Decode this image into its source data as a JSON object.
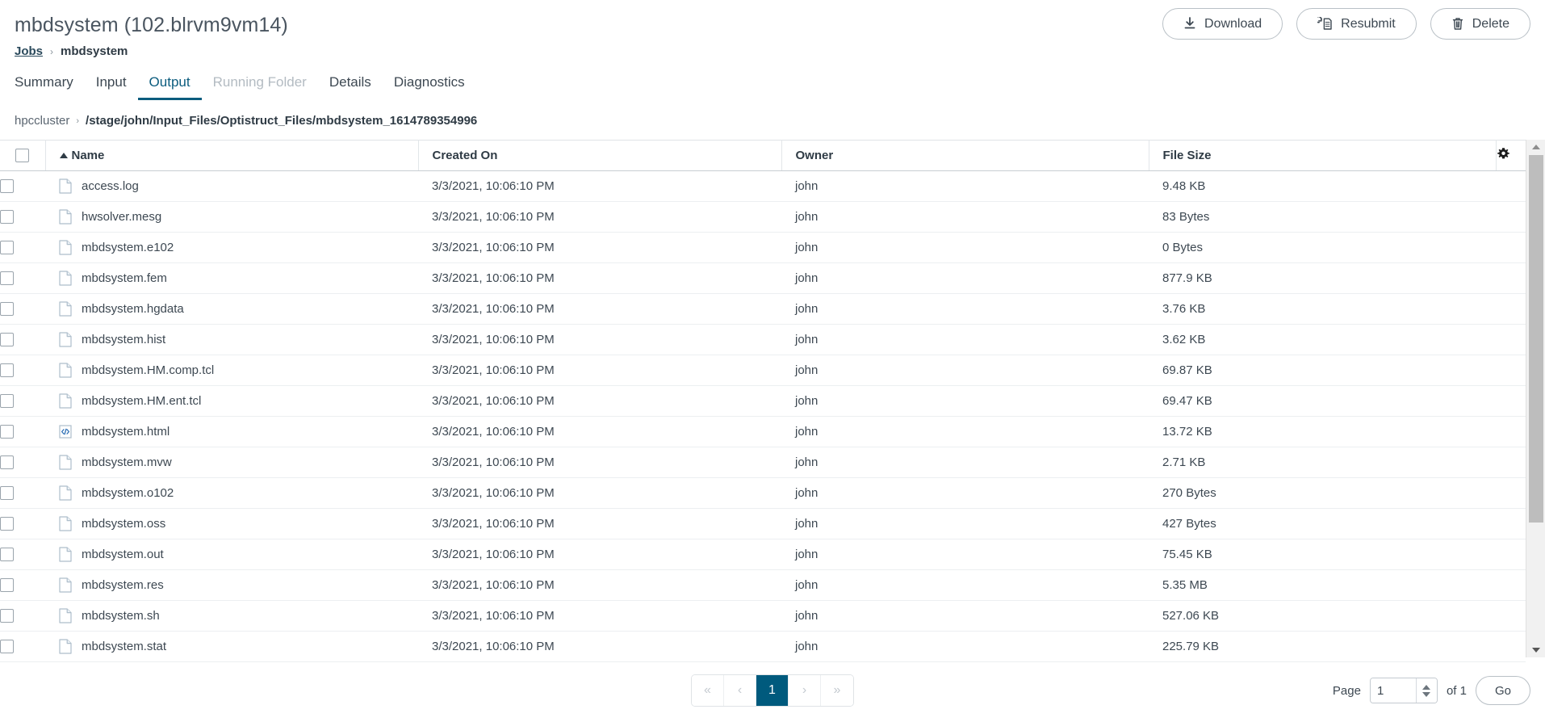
{
  "header": {
    "job_title": "mbdsystem (102.blrvm9vm14)",
    "breadcrumb": {
      "root": "Jobs",
      "separator": "›",
      "current": "mbdsystem"
    },
    "actions": [
      {
        "label": "Download",
        "icon": "download-icon"
      },
      {
        "label": "Resubmit",
        "icon": "resubmit-icon"
      },
      {
        "label": "Delete",
        "icon": "trash-icon"
      }
    ]
  },
  "tabs": [
    {
      "label": "Summary",
      "state": "normal"
    },
    {
      "label": "Input",
      "state": "normal"
    },
    {
      "label": "Output",
      "state": "active"
    },
    {
      "label": "Running Folder",
      "state": "disabled"
    },
    {
      "label": "Details",
      "state": "normal"
    },
    {
      "label": "Diagnostics",
      "state": "normal"
    }
  ],
  "pathbar": {
    "host": "hpccluster",
    "separator": "›",
    "path": "/stage/john/Input_Files/Optistruct_Files/mbdsystem_1614789354996"
  },
  "table": {
    "columns": {
      "name": "Name",
      "created_on": "Created On",
      "owner": "Owner",
      "file_size": "File Size"
    },
    "sort": {
      "column": "Name",
      "direction": "asc"
    },
    "settings_icon": "gear-icon",
    "rows": [
      {
        "name": "access.log",
        "icon": "file-icon",
        "created_on": "3/3/2021, 10:06:10 PM",
        "owner": "john",
        "size": "9.48 KB"
      },
      {
        "name": "hwsolver.mesg",
        "icon": "file-icon",
        "created_on": "3/3/2021, 10:06:10 PM",
        "owner": "john",
        "size": "83 Bytes"
      },
      {
        "name": "mbdsystem.e102",
        "icon": "file-icon",
        "created_on": "3/3/2021, 10:06:10 PM",
        "owner": "john",
        "size": "0 Bytes"
      },
      {
        "name": "mbdsystem.fem",
        "icon": "file-icon",
        "created_on": "3/3/2021, 10:06:10 PM",
        "owner": "john",
        "size": "877.9 KB"
      },
      {
        "name": "mbdsystem.hgdata",
        "icon": "file-icon",
        "created_on": "3/3/2021, 10:06:10 PM",
        "owner": "john",
        "size": "3.76 KB"
      },
      {
        "name": "mbdsystem.hist",
        "icon": "file-icon",
        "created_on": "3/3/2021, 10:06:10 PM",
        "owner": "john",
        "size": "3.62 KB"
      },
      {
        "name": "mbdsystem.HM.comp.tcl",
        "icon": "file-icon",
        "created_on": "3/3/2021, 10:06:10 PM",
        "owner": "john",
        "size": "69.87 KB"
      },
      {
        "name": "mbdsystem.HM.ent.tcl",
        "icon": "file-icon",
        "created_on": "3/3/2021, 10:06:10 PM",
        "owner": "john",
        "size": "69.47 KB"
      },
      {
        "name": "mbdsystem.html",
        "icon": "code-file-icon",
        "created_on": "3/3/2021, 10:06:10 PM",
        "owner": "john",
        "size": "13.72 KB"
      },
      {
        "name": "mbdsystem.mvw",
        "icon": "file-icon",
        "created_on": "3/3/2021, 10:06:10 PM",
        "owner": "john",
        "size": "2.71 KB"
      },
      {
        "name": "mbdsystem.o102",
        "icon": "file-icon",
        "created_on": "3/3/2021, 10:06:10 PM",
        "owner": "john",
        "size": "270 Bytes"
      },
      {
        "name": "mbdsystem.oss",
        "icon": "file-icon",
        "created_on": "3/3/2021, 10:06:10 PM",
        "owner": "john",
        "size": "427 Bytes"
      },
      {
        "name": "mbdsystem.out",
        "icon": "file-icon",
        "created_on": "3/3/2021, 10:06:10 PM",
        "owner": "john",
        "size": "75.45 KB"
      },
      {
        "name": "mbdsystem.res",
        "icon": "file-icon",
        "created_on": "3/3/2021, 10:06:10 PM",
        "owner": "john",
        "size": "5.35 MB"
      },
      {
        "name": "mbdsystem.sh",
        "icon": "file-icon",
        "created_on": "3/3/2021, 10:06:10 PM",
        "owner": "john",
        "size": "527.06 KB"
      },
      {
        "name": "mbdsystem.stat",
        "icon": "file-icon",
        "created_on": "3/3/2021, 10:06:10 PM",
        "owner": "john",
        "size": "225.79 KB"
      }
    ]
  },
  "pagination": {
    "first_label": "«",
    "prev_label": "‹",
    "pages": [
      "1"
    ],
    "active_page": "1",
    "next_label": "›",
    "last_label": "»",
    "page_label": "Page",
    "page_value": "1",
    "of_label": "of 1",
    "go_label": "Go"
  },
  "colors": {
    "accent": "#005a7d",
    "text": "#3d4852",
    "muted": "#b3bbc2",
    "border": "#dfe3e6"
  }
}
